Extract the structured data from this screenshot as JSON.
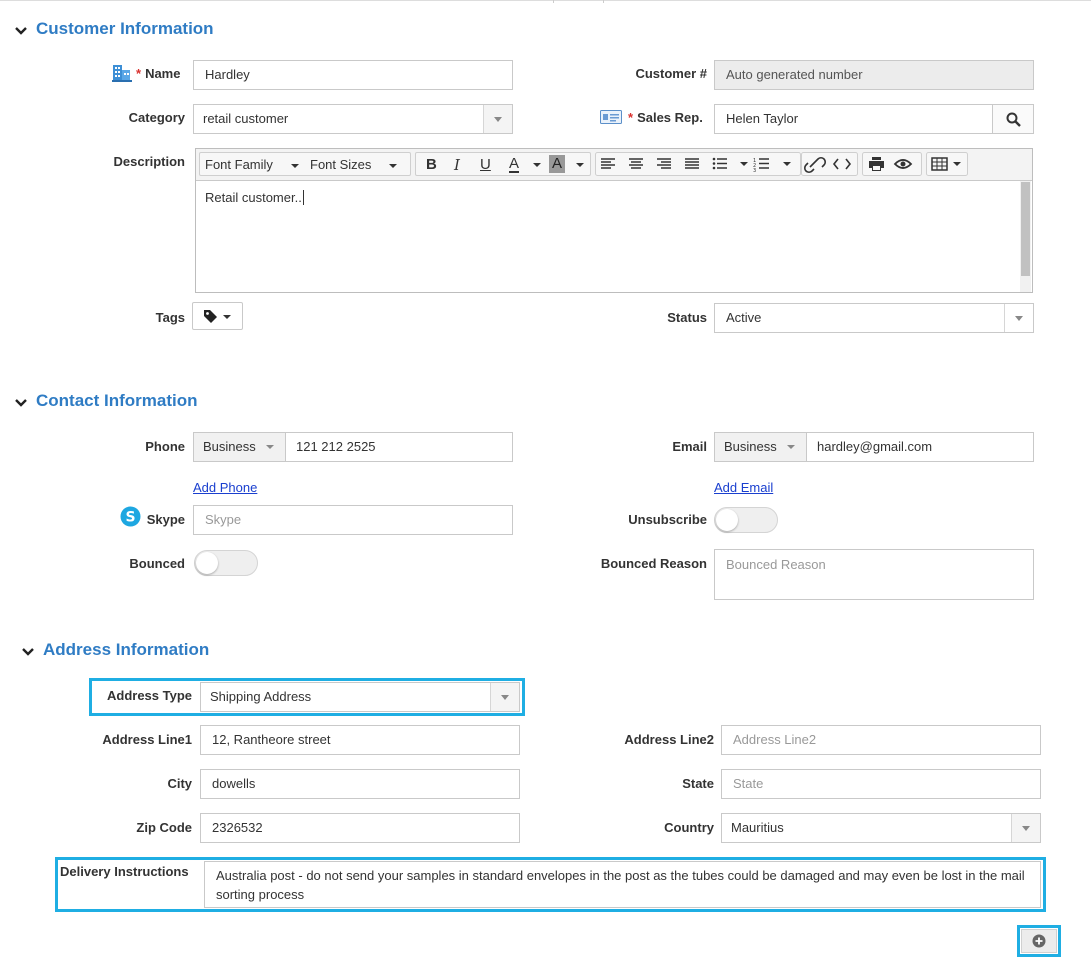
{
  "sections": {
    "customer": "Customer Information",
    "contact": "Contact Information",
    "address": "Address Information"
  },
  "customer": {
    "name_label": "Name",
    "name_value": "Hardley",
    "customer_no_label": "Customer #",
    "customer_no_value": "Auto generated number",
    "category_label": "Category",
    "category_value": "retail customer",
    "sales_rep_label": "Sales Rep.",
    "sales_rep_value": "Helen Taylor",
    "description_label": "Description",
    "description_value": "Retail customer..",
    "toolbar": {
      "font_family": "Font Family",
      "font_sizes": "Font Sizes"
    },
    "tags_label": "Tags",
    "status_label": "Status",
    "status_value": "Active",
    "required_mark": "*"
  },
  "contact": {
    "phone_label": "Phone",
    "phone_type": "Business",
    "phone_value": "121 212 2525",
    "add_phone": "Add Phone",
    "email_label": "Email",
    "email_type": "Business",
    "email_value": "hardley@gmail.com",
    "add_email": "Add Email",
    "skype_label": "Skype",
    "skype_placeholder": "Skype",
    "unsubscribe_label": "Unsubscribe",
    "bounced_label": "Bounced",
    "bounced_reason_label": "Bounced Reason",
    "bounced_reason_placeholder": "Bounced Reason"
  },
  "address": {
    "type_label": "Address Type",
    "type_value": "Shipping Address",
    "line1_label": "Address Line1",
    "line1_value": "12, Rantheore street",
    "line2_label": "Address Line2",
    "line2_placeholder": "Address Line2",
    "city_label": "City",
    "city_value": "dowells",
    "state_label": "State",
    "state_placeholder": "State",
    "zip_label": "Zip Code",
    "zip_value": "2326532",
    "country_label": "Country",
    "country_value": "Mauritius",
    "delivery_label": "Delivery Instructions",
    "delivery_value": "Australia post - do not send your samples in standard envelopes in the post as the tubes could be damaged and may even be lost in the mail sorting process"
  },
  "colors": {
    "accent": "#2f7cc4",
    "highlight": "#1faee3",
    "required": "#d9312f",
    "link": "#1a3fcf"
  }
}
